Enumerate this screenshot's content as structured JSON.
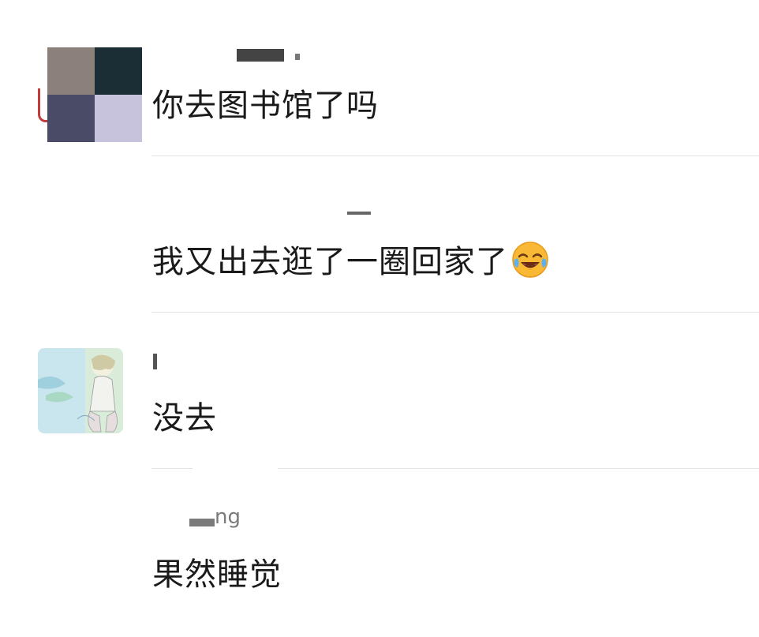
{
  "comments": [
    {
      "username": "",
      "text": "你去图书馆了吗",
      "avatar_colors": [
        "#8c807b",
        "#1b2e36",
        "#4a4b66",
        "#c7c3dc"
      ]
    },
    {
      "username": "",
      "text": "我又出去逛了一圈回家了",
      "emoji": "tears-of-joy-emoji"
    },
    {
      "username": "",
      "text": "没去",
      "avatar": "illustrated-girl-avatar"
    },
    {
      "username": "ng",
      "text": "果然睡觉"
    }
  ]
}
